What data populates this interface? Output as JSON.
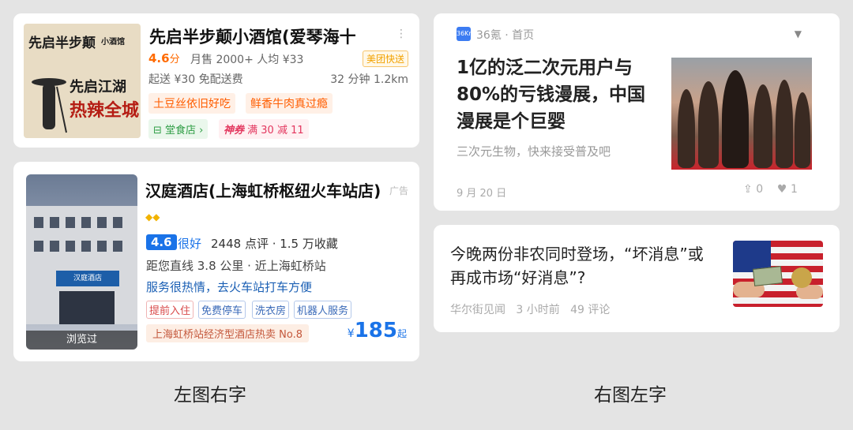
{
  "left_caption": "左图右字",
  "right_caption": "右图左字",
  "restaurant": {
    "image_text_1": "先启半步颠",
    "image_text_2": "小酒馆",
    "image_text_3": "先启江湖",
    "image_text_4": "热辣全城",
    "title": "先启半步颠小酒馆(爱琴海十",
    "more": "⋮",
    "score": "4.6",
    "score_unit": "分",
    "stats": "月售 2000+  人均 ¥33",
    "delivery_badge": "美团快送",
    "delivery": "起送 ¥30  免配送费",
    "time_distance": "32 分钟 1.2km",
    "chips": [
      "土豆丝依旧好吃",
      "鲜香牛肉真过瘾"
    ],
    "dine_in": "堂食店 ›",
    "coupon_label": "神券",
    "coupon": "满 30 减 11"
  },
  "hotel": {
    "sign_text": "汉庭酒店",
    "viewed": "浏览过",
    "title": "汉庭酒店(上海虹桥枢纽火车站店)",
    "diamonds": "◆◆",
    "ad_label": "广告",
    "score": "4.6",
    "score_label": "很好",
    "stats": "2448 点评 · 1.5 万收藏",
    "distance": "距您直线 3.8 公里 · 近上海虹桥站",
    "comment": "服务很热情，去火车站打车方便",
    "tags": [
      "提前入住",
      "免费停车",
      "洗衣房",
      "机器人服务"
    ],
    "rank": "上海虹桥站经济型酒店热卖 No.8",
    "price_currency": "¥",
    "price": "185",
    "price_suffix": "起"
  },
  "news_36kr": {
    "source_icon": "36Kr",
    "source": "36氪 · 首页",
    "title": "1亿的泛二次元用户与80%的亏钱漫展，中国漫展是个巨婴",
    "subtitle": "三次元生物，快来接受普及吧",
    "date": "9 月 20 日",
    "shares": "0",
    "likes": "1"
  },
  "news_wsc": {
    "title": "今晚两份非农同时登场，“坏消息”或再成市场“好消息”?",
    "source": "华尔街见闻",
    "time": "3 小时前",
    "comments": "49 评论"
  }
}
